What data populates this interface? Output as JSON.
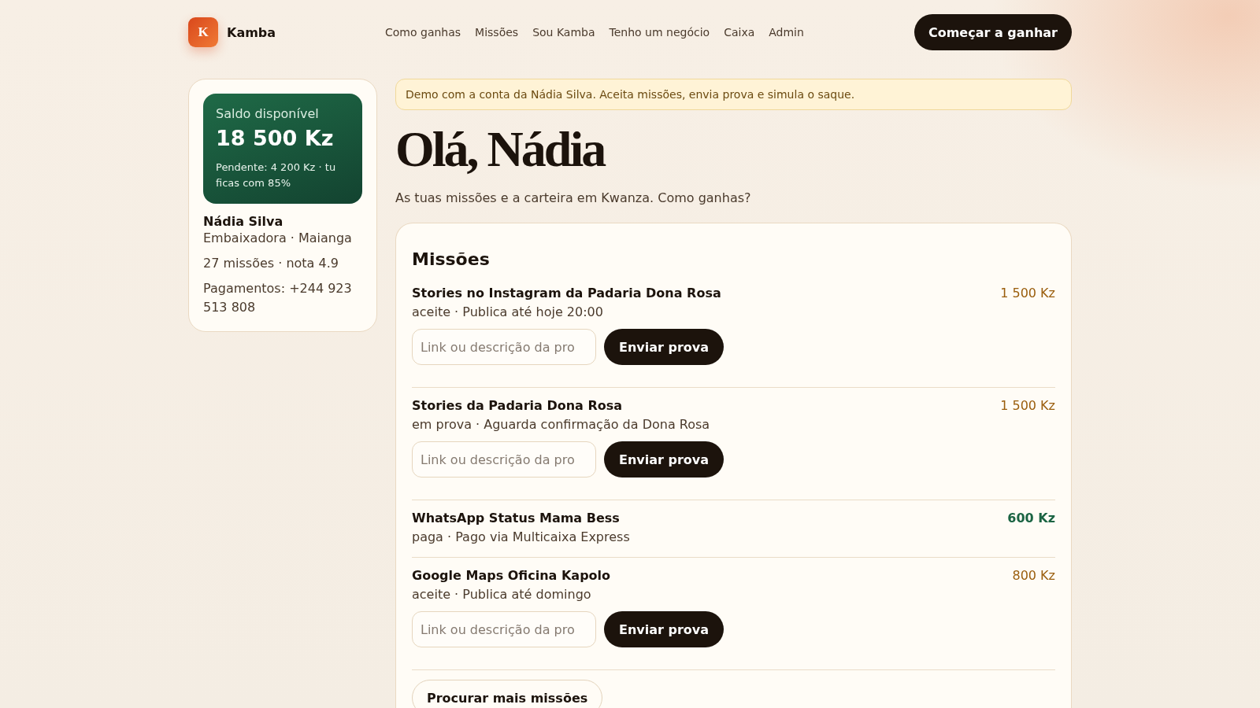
{
  "header": {
    "logo_letter": "K",
    "brand": "Kamba",
    "nav": [
      "Como ganhas",
      "Missões",
      "Sou Kamba",
      "Tenho um negócio",
      "Caixa",
      "Admin"
    ],
    "cta": "Começar a ganhar"
  },
  "profile": {
    "balance_label": "Saldo disponível",
    "balance": "18 500 Kz",
    "pending": "Pendente: 4 200 Kz · tu ficas com 85%",
    "name": "Nádia Silva",
    "role": "Embaixadora · Maianga",
    "stats": "27 missões · nota 4.9",
    "payments": "Pagamentos: +244 923 513 808"
  },
  "notice": "Demo com a conta da Nádia Silva. Aceita missões, envia prova e simula o saque.",
  "greeting": "Olá, Nádia",
  "subtitle": "As tuas missões e a carteira em Kwanza. Como ganhas?",
  "missions_panel": {
    "title": "Missões",
    "more_button": "Procurar mais missões",
    "missions": [
      {
        "title": "Stories no Instagram da Padaria Dona Rosa",
        "status": "aceite · Publica até hoje 20:00",
        "amount": "1 500 Kz",
        "paid": false,
        "proof_field": {
          "placeholder": "Link ou descrição da pro"
        },
        "button": "Enviar prova"
      },
      {
        "title": "Stories da Padaria Dona Rosa",
        "status": "em prova · Aguarda confirmação da Dona Rosa",
        "amount": "1 500 Kz",
        "paid": false,
        "proof_field": {
          "placeholder": "Link ou descrição da pro"
        },
        "button": "Enviar prova"
      },
      {
        "title": "WhatsApp Status Mama Bess",
        "status": "paga · Pago via Multicaixa Express",
        "amount": "600 Kz",
        "paid": true
      },
      {
        "title": "Google Maps Oficina Kapolo",
        "status": "aceite · Publica até domingo",
        "amount": "800 Kz",
        "paid": false,
        "proof_field": {
          "placeholder": "Link ou descrição da pro"
        },
        "button": "Enviar prova"
      }
    ]
  }
}
